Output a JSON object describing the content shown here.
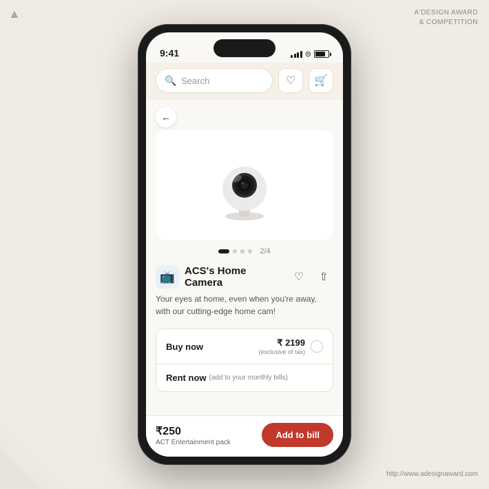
{
  "meta": {
    "award_logo": "A'DESIGN AWARD\n& COMPETITION",
    "url": "http://www.adesignaward.com"
  },
  "status_bar": {
    "time": "9:41",
    "signal": [
      3,
      5,
      7,
      9,
      11
    ],
    "battery_pct": 80
  },
  "search": {
    "placeholder": "Search"
  },
  "header_buttons": {
    "heart_label": "♡",
    "cart_label": "🛒"
  },
  "product": {
    "title": "ACS's Home Camera",
    "description": "Your eyes at home, even when you're away,\nwith our cutting-edge home cam!",
    "pagination": {
      "current": 2,
      "total": 4,
      "label": "2/4"
    },
    "buy": {
      "label": "Buy now",
      "price": "₹ 2199",
      "price_note": "(exclusive of tax)"
    },
    "rent": {
      "label": "Rent now",
      "sublabel": "(add to your monthly bills)"
    }
  },
  "bottom_bar": {
    "price": "₹250",
    "pack_name": "ACT Entertainment pack",
    "add_button": "Add to bill"
  }
}
